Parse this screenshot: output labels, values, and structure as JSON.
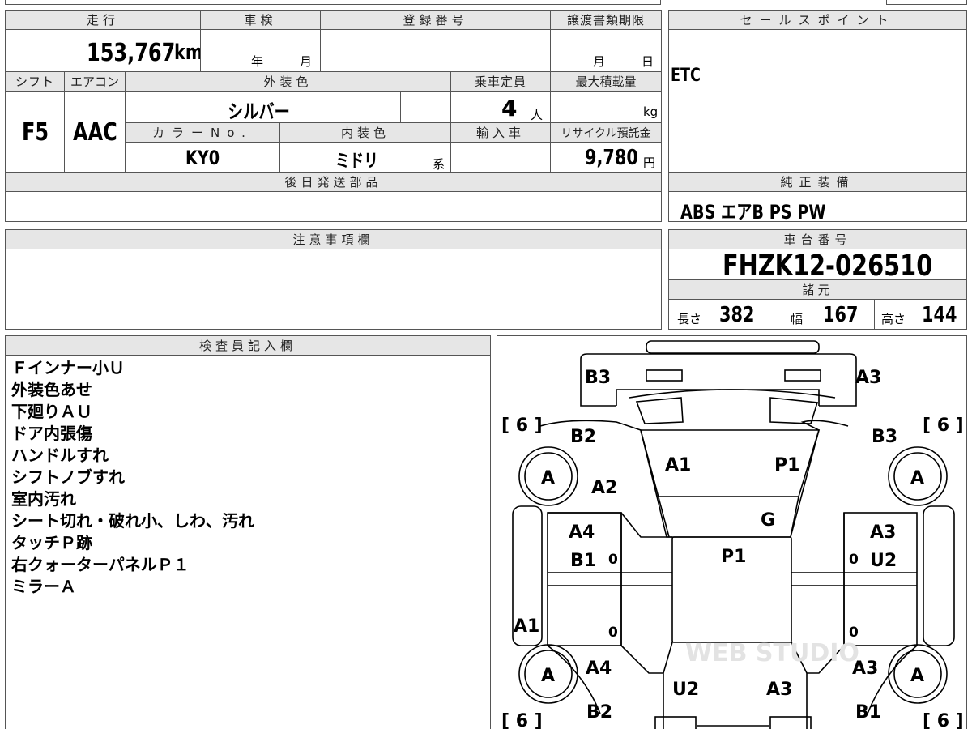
{
  "mileage": {
    "label": "走行",
    "value": "153,767",
    "unit": "km"
  },
  "inspection": {
    "label": "車検",
    "year_unit": "年",
    "month_unit": "月"
  },
  "registration": {
    "label": "登録番号"
  },
  "transfer_deadline": {
    "label": "譲渡書類期限",
    "month_unit": "月",
    "day_unit": "日"
  },
  "sale_points": {
    "label": "セールスポイント",
    "value": "ETC"
  },
  "shift": {
    "label": "シフト",
    "value": "F5"
  },
  "aircon": {
    "label": "エアコン",
    "value": "AAC"
  },
  "exterior_color": {
    "label": "外装色",
    "value": "シルバー"
  },
  "capacity": {
    "label": "乗車定員",
    "value": "4",
    "unit": "人"
  },
  "max_load": {
    "label": "最大積載量",
    "unit": "kg"
  },
  "color_no": {
    "label": "カラーNo.",
    "value": "KY0"
  },
  "interior_color": {
    "label": "内装色",
    "value": "ミドリ",
    "suffix": "系"
  },
  "import": {
    "label": "輸入車"
  },
  "recycle": {
    "label": "リサイクル預託金",
    "value": "9,780",
    "unit": "円"
  },
  "later_parts": {
    "label": "後日発送部品"
  },
  "genuine_equipment": {
    "label": "純正装備",
    "value": "ABS エアB PS PW"
  },
  "caution": {
    "label": "注意事項欄"
  },
  "chassis": {
    "label": "車台番号",
    "value": "FHZK12-026510"
  },
  "specs": {
    "label": "諸元",
    "length_label": "長さ",
    "length": "382",
    "width_label": "幅",
    "width": "167",
    "height_label": "高さ",
    "height": "144"
  },
  "inspector": {
    "label": "検査員記入欄",
    "notes": [
      "Ｆインナー小Ｕ",
      "外装色あせ",
      "下廻りＡＵ",
      "ドア内張傷",
      "ハンドルすれ",
      "シフトノブすれ",
      "室内汚れ",
      "シート切れ・破れ小、しわ、汚れ",
      "タッチＰ跡",
      "右クォーターパネルＰ１",
      "ミラーＡ"
    ]
  },
  "diagram": {
    "tire_size": "[ 6 ]",
    "tire_grade": "A",
    "codes": {
      "front_left": "B3",
      "front_right": "A3",
      "left_front_fender": "B2",
      "right_front_fender": "B3",
      "windshield_left": "A1",
      "windshield_right": "P1",
      "left_front_lower": "A2",
      "hood_rear": "G",
      "left_front_door_top": "A4",
      "left_front_door": "B1",
      "roof": "P1",
      "right_front_door_top": "A3",
      "right_front_door": "U2",
      "left_rocker": "A1",
      "left_rear_quarter": "A4",
      "right_rear_quarter": "A3",
      "rear_left": "U2",
      "rear_right": "A3",
      "rear_left_bumper": "B2",
      "rear_right_bumper": "B1"
    },
    "zero": "0",
    "watermark": "WEB STUDIO"
  }
}
